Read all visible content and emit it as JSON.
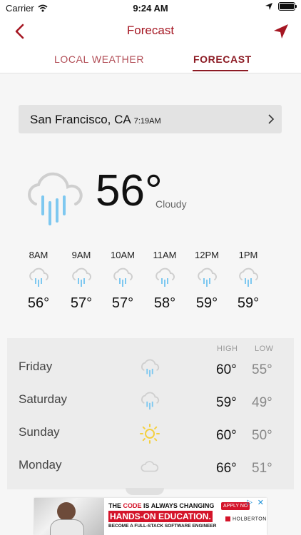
{
  "status_bar": {
    "carrier": "Carrier",
    "time": "9:24 AM"
  },
  "nav": {
    "title": "Forecast"
  },
  "tabs": [
    {
      "label": "LOCAL WEATHER",
      "selected": false
    },
    {
      "label": "FORECAST",
      "selected": true
    }
  ],
  "location": {
    "city": "San Francisco, CA",
    "time": "7:19AM"
  },
  "current": {
    "temp": "56°",
    "condition": "Cloudy",
    "icon": "rain-icon"
  },
  "hourly": [
    {
      "time": "8AM",
      "temp": "56°",
      "icon": "rain-icon"
    },
    {
      "time": "9AM",
      "temp": "57°",
      "icon": "rain-icon"
    },
    {
      "time": "10AM",
      "temp": "57°",
      "icon": "rain-icon"
    },
    {
      "time": "11AM",
      "temp": "58°",
      "icon": "rain-icon"
    },
    {
      "time": "12PM",
      "temp": "59°",
      "icon": "rain-icon"
    },
    {
      "time": "1PM",
      "temp": "59°",
      "icon": "rain-icon"
    }
  ],
  "daily": {
    "high_label": "HIGH",
    "low_label": "LOW",
    "days": [
      {
        "day": "Friday",
        "icon": "rain-icon",
        "high": "60°",
        "low": "55°"
      },
      {
        "day": "Saturday",
        "icon": "rain-icon",
        "high": "59°",
        "low": "49°"
      },
      {
        "day": "Sunday",
        "icon": "sun-icon",
        "high": "60°",
        "low": "50°"
      },
      {
        "day": "Monday",
        "icon": "cloud-icon",
        "high": "66°",
        "low": "51°"
      }
    ]
  },
  "ad": {
    "line1_a": "THE ",
    "line1_b": "CODE",
    "line1_c": " IS ALWAYS CHANGING",
    "line2": "HANDS-ON EDUCATION.",
    "line3": "BECOME A FULL-STACK SOFTWARE ENGINEER",
    "apply": "APPLY NO",
    "brand": "HOLBERTON"
  },
  "colors": {
    "accent": "#a51622",
    "icon_blue": "#7ec8f0",
    "sun": "#f4d03f"
  }
}
